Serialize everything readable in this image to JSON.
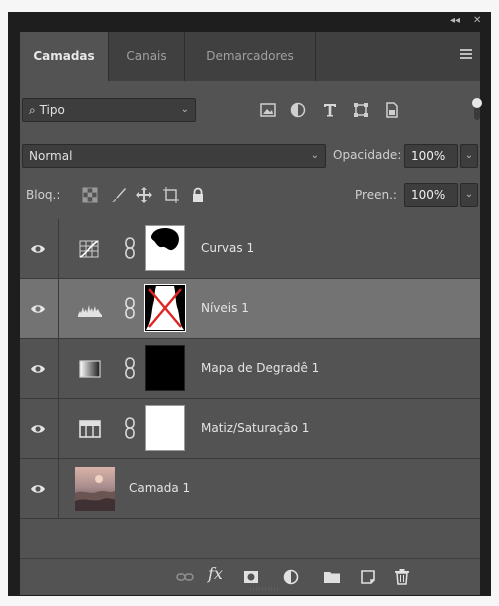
{
  "tabs": [
    "Camadas",
    "Canais",
    "Demarcadores"
  ],
  "filter": {
    "kind_label": "Tipo",
    "icons": [
      "image-filter-icon",
      "adjustment-filter-icon",
      "type-filter-icon",
      "shape-filter-icon",
      "smart-object-filter-icon"
    ]
  },
  "blend": {
    "mode": "Normal",
    "opacity_label": "Opacidade:",
    "opacity_value": "100%"
  },
  "lock": {
    "label": "Bloq.:",
    "fill_label": "Preen.:",
    "fill_value": "100%"
  },
  "layers": [
    {
      "name": "Curvas 1",
      "type": "curves-adjustment-icon",
      "visible": true,
      "selected": false
    },
    {
      "name": "Níveis 1",
      "type": "levels-adjustment-icon",
      "visible": true,
      "selected": true
    },
    {
      "name": "Mapa de Degradê 1",
      "type": "gradient-map-adjustment-icon",
      "visible": true,
      "selected": false
    },
    {
      "name": "Matiz/Saturação 1",
      "type": "hue-saturation-adjustment-icon",
      "visible": true,
      "selected": false
    },
    {
      "name": "Camada 1",
      "type": "pixel-layer",
      "visible": true,
      "selected": false
    }
  ],
  "footer": {
    "fx_label": "fx"
  }
}
